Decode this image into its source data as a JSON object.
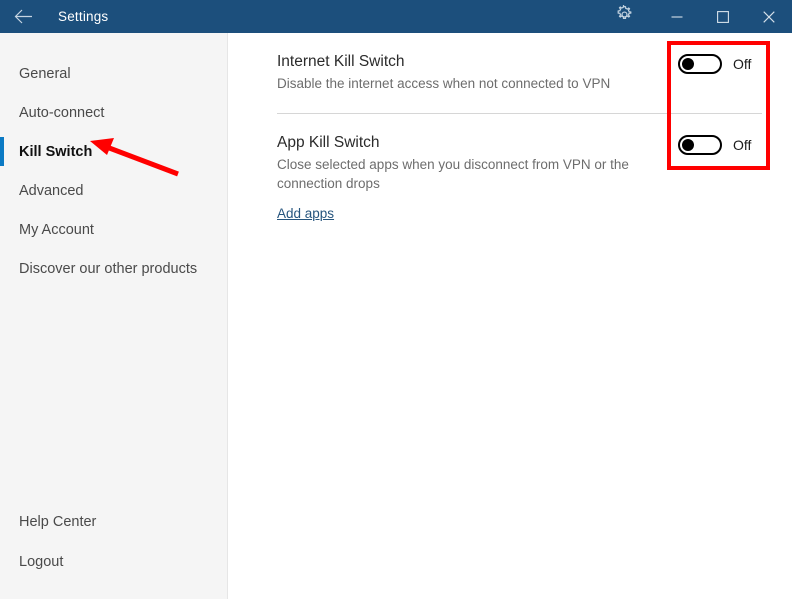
{
  "window": {
    "title": "Settings",
    "titlebar_color": "#1c4f7c",
    "back_icon": "back-arrow-icon",
    "gear_icon": "gear-icon",
    "minimize_icon": "minimize-icon",
    "maximize_icon": "maximize-icon",
    "close_icon": "close-icon"
  },
  "sidebar": {
    "background": "#f5f5f5",
    "selected_indicator_color": "#0b7ac4",
    "items": [
      {
        "label": "General",
        "selected": false
      },
      {
        "label": "Auto-connect",
        "selected": false
      },
      {
        "label": "Kill Switch",
        "selected": true
      },
      {
        "label": "Advanced",
        "selected": false
      },
      {
        "label": "My Account",
        "selected": false
      },
      {
        "label": "Discover our other products",
        "selected": false
      }
    ],
    "bottom_items": [
      {
        "label": "Help Center"
      },
      {
        "label": "Logout"
      }
    ]
  },
  "main": {
    "sections": [
      {
        "title": "Internet Kill Switch",
        "description": "Disable the internet access when not connected to VPN",
        "toggle": {
          "state": "Off",
          "on": false
        }
      },
      {
        "title": "App Kill Switch",
        "description": "Close selected apps when you disconnect from VPN or the connection drops",
        "link": "Add apps",
        "toggle": {
          "state": "Off",
          "on": false
        }
      }
    ]
  },
  "annotations": {
    "highlight_color": "#ff0000",
    "box_target": "toggle-switches",
    "arrow_target": "sidebar-item-kill-switch"
  }
}
